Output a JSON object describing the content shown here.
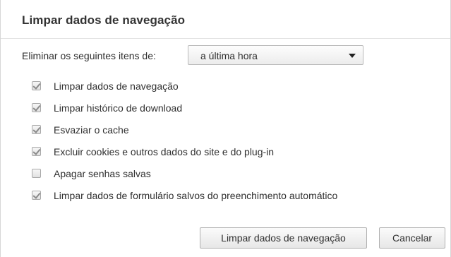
{
  "dialog": {
    "title": "Limpar dados de navegação",
    "range_label": "Eliminar os seguintes itens de:",
    "range_select": {
      "selected": "a última hora"
    },
    "options": [
      {
        "label": "Limpar dados de navegação",
        "checked": true
      },
      {
        "label": "Limpar histórico de download",
        "checked": true
      },
      {
        "label": "Esvaziar o cache",
        "checked": true
      },
      {
        "label": "Excluir cookies e outros dados do site e do plug-in",
        "checked": true
      },
      {
        "label": "Apagar senhas salvas",
        "checked": false
      },
      {
        "label": "Limpar dados de formulário salvos do preenchimento automático",
        "checked": true
      }
    ],
    "buttons": {
      "confirm_label": "Limpar dados de navegação",
      "cancel_label": "Cancelar"
    }
  }
}
